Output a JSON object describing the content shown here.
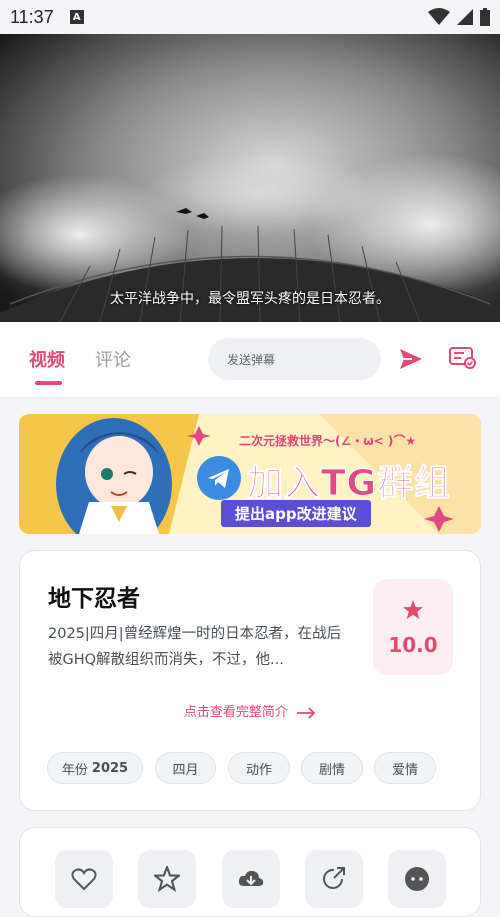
{
  "status": {
    "time": "11:37",
    "a_icon": "A"
  },
  "video": {
    "subtitle": "太平洋战争中，最令盟军头疼的是日本忍者。"
  },
  "tabs": {
    "video": "视频",
    "comments": "评论"
  },
  "danmaku": {
    "placeholder": "发送弹幕"
  },
  "banner": {
    "topline": "二次元拯救世界～(∠・ω< )⌒★",
    "title": "加入TG群组",
    "subtitle": "提出app改进建议"
  },
  "info": {
    "title": "地下忍者",
    "description": "2025|四月|曾经辉煌一时的日本忍者，在战后被GHQ解散组织而消失，不过，他...",
    "score": "10.0",
    "full_intro": "点击查看完整简介",
    "chips": [
      {
        "label": "年份",
        "value": "2025"
      },
      {
        "label": "四月"
      },
      {
        "label": "动作"
      },
      {
        "label": "剧情"
      },
      {
        "label": "爱情"
      }
    ]
  },
  "colors": {
    "accent": "#e24a70",
    "chip_bg": "#f1f3f6"
  },
  "icons": [
    "wifi-icon",
    "signal-icon",
    "battery-icon",
    "send-icon",
    "danmaku-settings-icon",
    "star-icon",
    "arrow-right-icon",
    "like-icon",
    "favorite-icon",
    "download-icon",
    "share-icon",
    "more-icon"
  ]
}
